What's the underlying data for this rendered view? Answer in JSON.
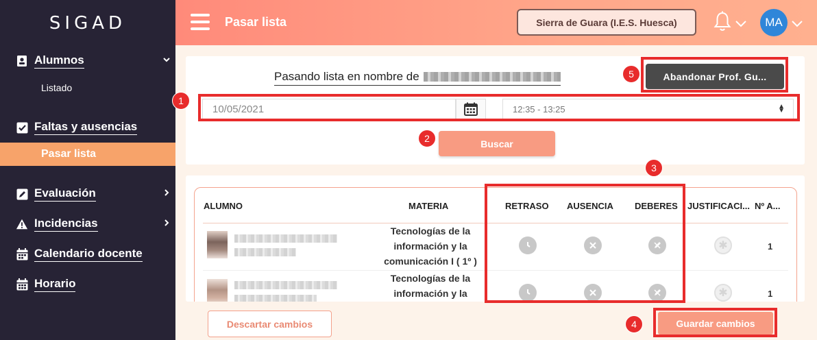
{
  "app": {
    "brand": "SIGAD"
  },
  "sidebar": {
    "items": [
      {
        "label": "Alumnos",
        "icon": "student-card-icon",
        "has_chevron": "down"
      },
      {
        "label": "Listado",
        "sub": true
      },
      {
        "label": "Faltas y ausencias",
        "icon": "checkbox-icon"
      },
      {
        "label": "Pasar lista",
        "sub": true,
        "active": true
      },
      {
        "label": "Evaluación",
        "icon": "edit-icon",
        "has_chevron": "right"
      },
      {
        "label": "Incidencias",
        "icon": "warning-icon",
        "has_chevron": "right"
      },
      {
        "label": "Calendario docente",
        "icon": "calendar-icon"
      },
      {
        "label": "Horario",
        "icon": "calendar-grid-icon"
      }
    ]
  },
  "header": {
    "title": "Pasar lista",
    "school": "Sierra de Guara (I.E.S. Huesca)",
    "avatar_initials": "MA"
  },
  "form": {
    "on_behalf_label": "Pasando lista en nombre de",
    "leave_button": "Abandonar Prof. Gu...",
    "date_value": "10/05/2021",
    "time_value": "12:35 - 13:25",
    "search_button": "Buscar"
  },
  "table": {
    "columns": [
      "ALUMNO",
      "MATERIA",
      "RETRASO",
      "AUSENCIA",
      "DEBERES",
      "JUSTIFICACI...",
      "Nº A..."
    ],
    "rows": [
      {
        "subject": [
          "Tecnologías de la",
          "información y la",
          "comunicación I ( 1º )"
        ],
        "count": "1"
      },
      {
        "subject": [
          "Tecnologías de la",
          "información y la"
        ],
        "count": "1"
      }
    ]
  },
  "footer": {
    "discard_button": "Descartar cambios",
    "save_button": "Guardar cambios"
  },
  "annotations": [
    "1",
    "2",
    "3",
    "4",
    "5"
  ],
  "colors": {
    "accent": "#f89b82",
    "sidebar": "#272335",
    "annotation": "#e82c2c",
    "avatar": "#2f86d9"
  }
}
